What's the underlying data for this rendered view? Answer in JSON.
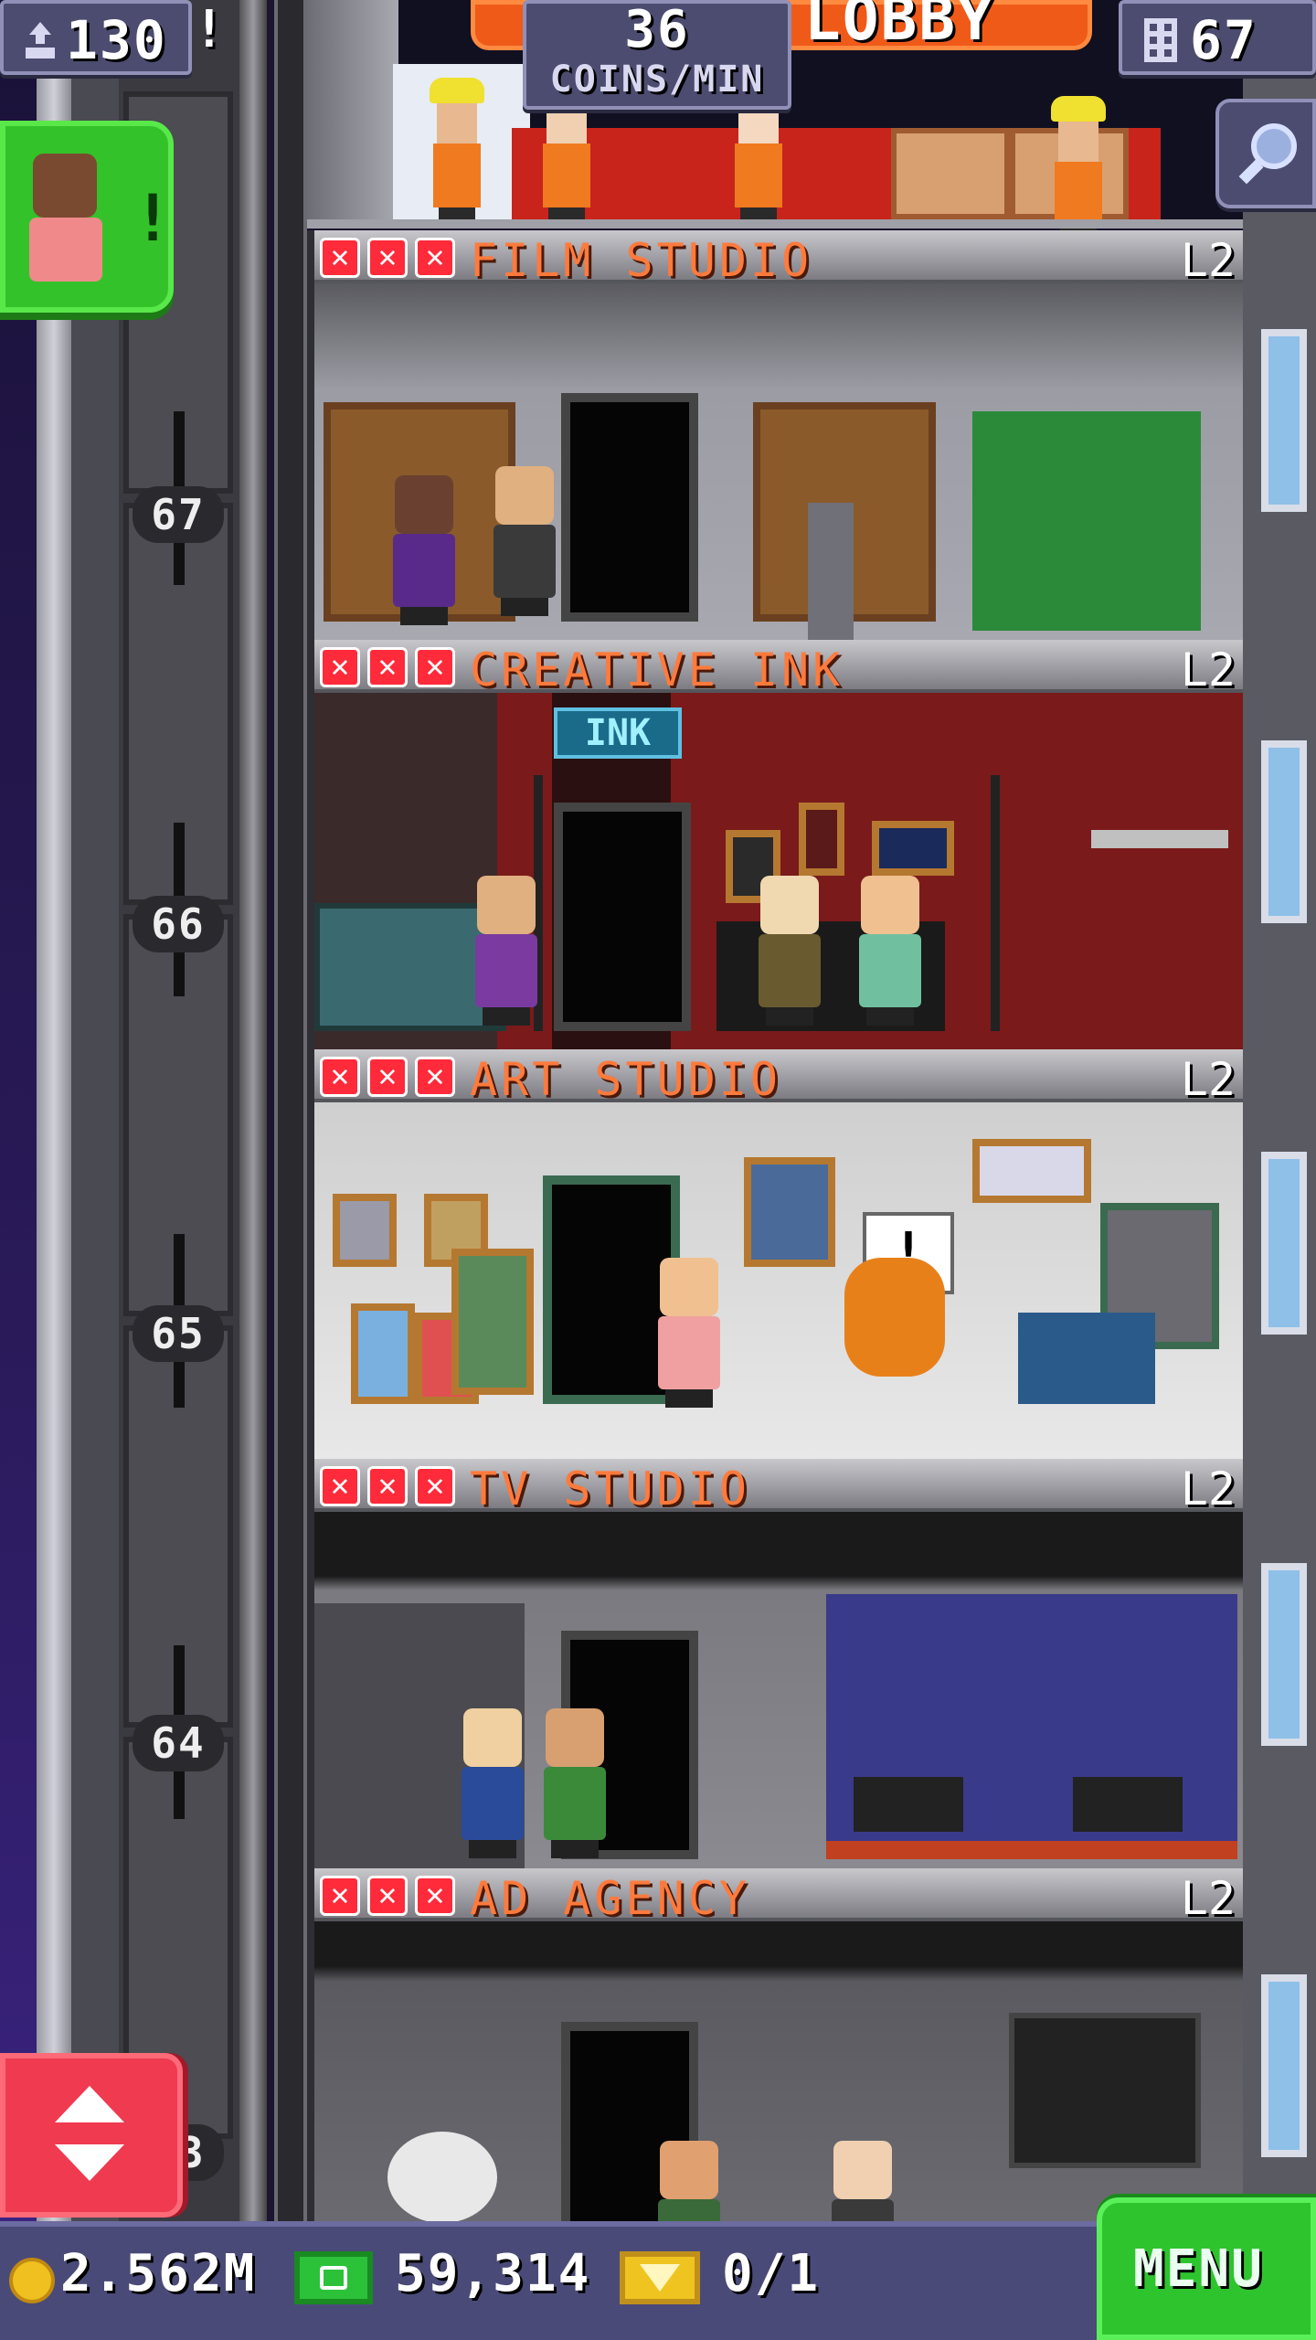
{
  "hud": {
    "population": "130",
    "coins_per_min_value": "36",
    "coins_per_min_label": "COINS/MIN",
    "floors_count": "67",
    "lobby_banner": "LOBBY"
  },
  "floors": [
    {
      "name": "FILM STUDIO",
      "level": "L2",
      "number": "67"
    },
    {
      "name": "CREATIVE INK",
      "level": "L2",
      "number": "66"
    },
    {
      "name": "ART STUDIO",
      "level": "L2",
      "number": "65"
    },
    {
      "name": "TV STUDIO",
      "level": "L2",
      "number": "64"
    },
    {
      "name": "AD AGENCY",
      "level": "L2",
      "number": "63"
    }
  ],
  "room_signs": {
    "creative_ink_sign": "INK"
  },
  "bottom_bar": {
    "coins": "2.562M",
    "tower_bux": "59,314",
    "tickets": "0/1",
    "menu_label": "MENU"
  },
  "icons": {
    "population": "person-up-arrow-icon",
    "floors": "building-icon",
    "search": "magnifier-icon",
    "elevator": "up-down-arrows-icon",
    "coin": "coin-icon",
    "bux": "tower-bux-icon",
    "ticket": "golden-ticket-icon",
    "stock_status": "red-x-icon"
  },
  "colors": {
    "floor_name": "#ff7a3c",
    "menu_button": "#2ec42e",
    "visitor_button": "#34c22a",
    "elevator_button": "#f03a50"
  }
}
